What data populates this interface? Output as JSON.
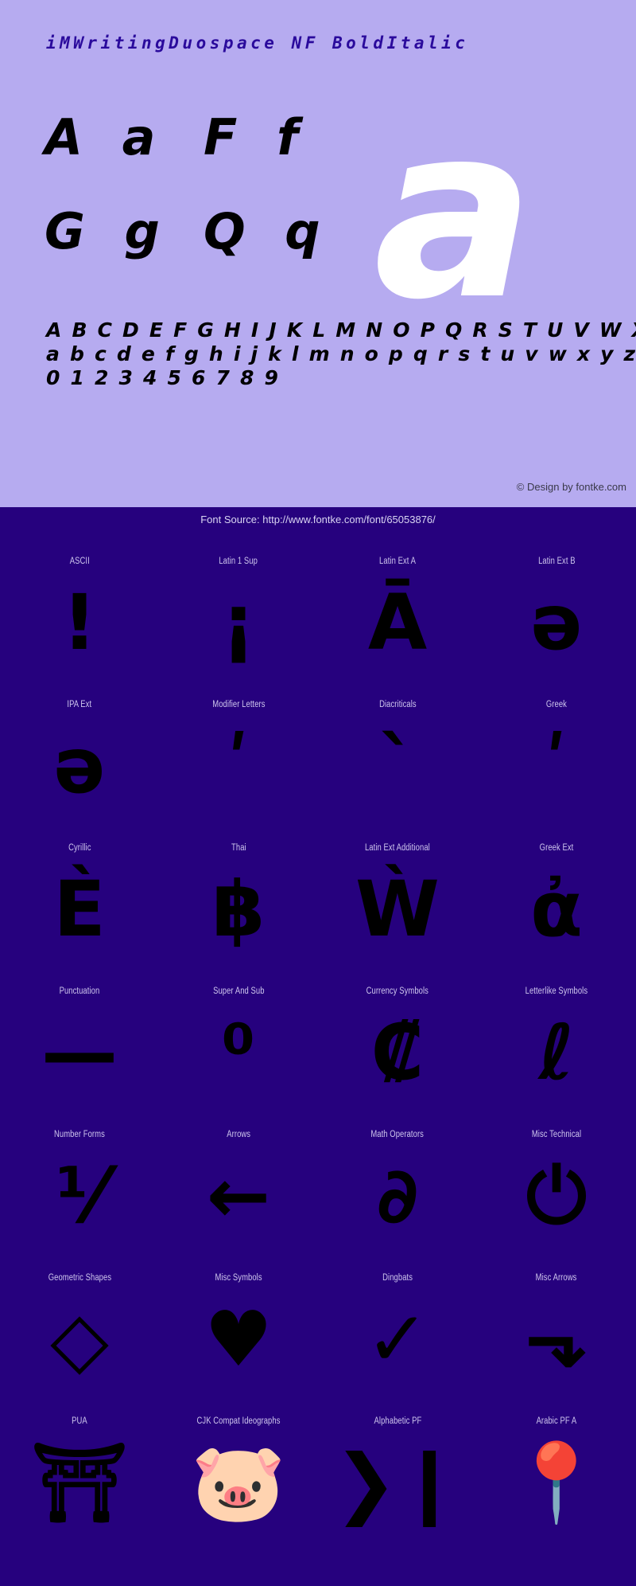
{
  "specimen": {
    "title": "iMWritingDuospace NF BoldItalic",
    "letter_pairs": [
      [
        "A a",
        "F f"
      ],
      [
        "G g",
        "Q q"
      ]
    ],
    "big_glyph": "a",
    "alphabet_uppercase": "A B C D E F G H I J K L M N O P Q R S T U V W X Y Z",
    "alphabet_lowercase": "a b c d e f g h i j k l m n o p q r s t u v w x y z",
    "digits": "0 1 2 3 4 5 6 7 8 9",
    "copyright": "© Design by fontke.com",
    "background_color": "#b6abf0",
    "title_color": "#2a0a9c",
    "big_glyph_color": "#ffffff"
  },
  "coverage": {
    "font_source": "Font Source: http://www.fontke.com/font/65053876/",
    "background_color": "#26017e",
    "label_color": "#cfc7ee",
    "glyph_color": "#000000",
    "blocks": [
      {
        "label": "ASCII",
        "glyph": "!"
      },
      {
        "label": "Latin 1 Sup",
        "glyph": "¡"
      },
      {
        "label": "Latin Ext A",
        "glyph": "Ā"
      },
      {
        "label": "Latin Ext B",
        "glyph": "ə"
      },
      {
        "label": "IPA Ext",
        "glyph": "ə"
      },
      {
        "label": "Modifier Letters",
        "glyph": "ʹ"
      },
      {
        "label": "Diacriticals",
        "glyph": "ˋ"
      },
      {
        "label": "Greek",
        "glyph": "ʹ"
      },
      {
        "label": "Cyrillic",
        "glyph": "Ѐ"
      },
      {
        "label": "Thai",
        "glyph": "฿"
      },
      {
        "label": "Latin Ext Additional",
        "glyph": "Ẁ"
      },
      {
        "label": "Greek Ext",
        "glyph": "ἀ"
      },
      {
        "label": "Punctuation",
        "glyph": "—"
      },
      {
        "label": "Super And Sub",
        "glyph": "⁰"
      },
      {
        "label": "Currency Symbols",
        "glyph": "₡"
      },
      {
        "label": "Letterlike Symbols",
        "glyph": "ℓ"
      },
      {
        "label": "Number Forms",
        "glyph": "⅟"
      },
      {
        "label": "Arrows",
        "glyph": "←"
      },
      {
        "label": "Math Operators",
        "glyph": "∂"
      },
      {
        "label": "Misc Technical",
        "glyph": "⏻"
      },
      {
        "label": "Geometric Shapes",
        "glyph": "◇"
      },
      {
        "label": "Misc Symbols",
        "glyph": "♥"
      },
      {
        "label": "Dingbats",
        "glyph": "✓"
      },
      {
        "label": "Misc Arrows",
        "glyph": "⬎"
      },
      {
        "label": "PUA",
        "glyph": "⛩"
      },
      {
        "label": "CJK Compat Ideographs",
        "glyph": "🐷"
      },
      {
        "label": "Alphabetic PF",
        "glyph": "❯❙"
      },
      {
        "label": "Arabic PF A",
        "glyph": "📍"
      }
    ]
  }
}
